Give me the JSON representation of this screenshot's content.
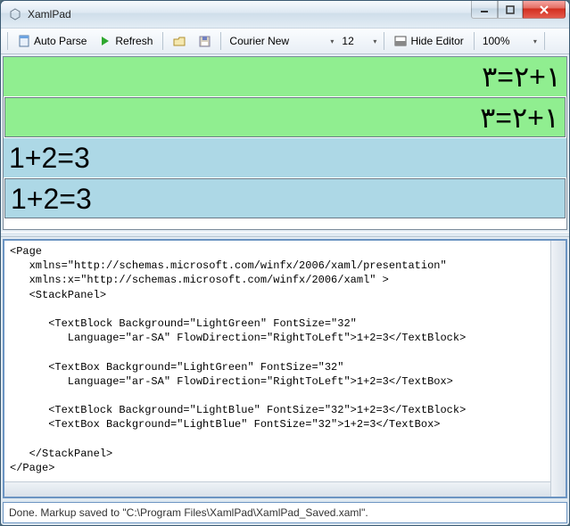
{
  "window": {
    "title": "XamlPad"
  },
  "toolbar": {
    "autoParse": "Auto Parse",
    "refresh": "Refresh",
    "font": "Courier New",
    "fontSize": "12",
    "hideEditor": "Hide Editor",
    "zoom": "100%"
  },
  "preview": {
    "row1": "١+٢=٣",
    "row2": "١+٢=٣",
    "row3": "1+2=3",
    "row4": "1+2=3"
  },
  "editor": {
    "text": "<Page\n   xmlns=\"http://schemas.microsoft.com/winfx/2006/xaml/presentation\"\n   xmlns:x=\"http://schemas.microsoft.com/winfx/2006/xaml\" >\n   <StackPanel>\n\n      <TextBlock Background=\"LightGreen\" FontSize=\"32\"\n         Language=\"ar-SA\" FlowDirection=\"RightToLeft\">1+2=3</TextBlock>\n\n      <TextBox Background=\"LightGreen\" FontSize=\"32\"\n         Language=\"ar-SA\" FlowDirection=\"RightToLeft\">1+2=3</TextBox>\n\n      <TextBlock Background=\"LightBlue\" FontSize=\"32\">1+2=3</TextBlock>\n      <TextBox Background=\"LightBlue\" FontSize=\"32\">1+2=3</TextBox>\n\n   </StackPanel>\n</Page>"
  },
  "status": {
    "text": "Done. Markup saved to \"C:\\Program Files\\XamlPad\\XamlPad_Saved.xaml\"."
  }
}
